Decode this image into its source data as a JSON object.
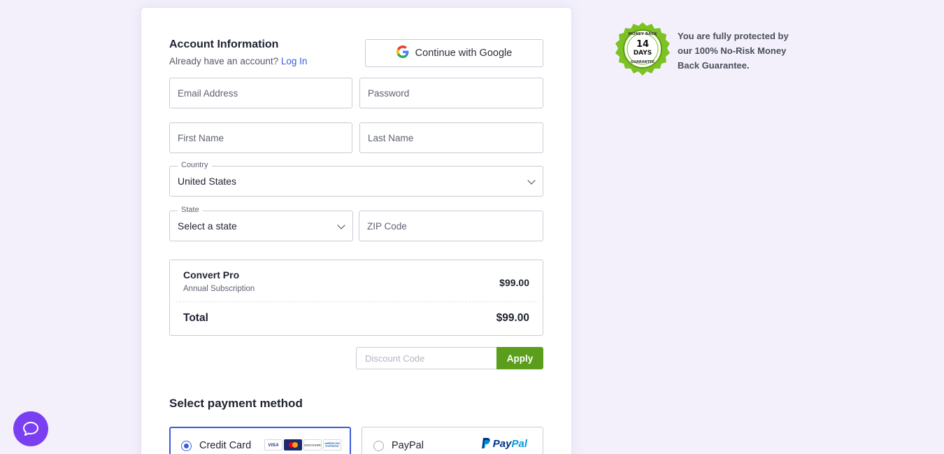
{
  "account": {
    "title": "Account Information",
    "subtitle_prefix": "Already have an account?",
    "login_link": "Log In",
    "google_button": "Continue with Google"
  },
  "form": {
    "email_placeholder": "Email Address",
    "password_placeholder": "Password",
    "first_name_placeholder": "First Name",
    "last_name_placeholder": "Last Name",
    "country_label": "Country",
    "country_value": "United States",
    "state_label": "State",
    "state_value": "Select a state",
    "zip_placeholder": "ZIP Code"
  },
  "summary": {
    "product_name": "Convert Pro",
    "product_plan": "Annual Subscription",
    "product_price": "$99.00",
    "total_label": "Total",
    "total_price": "$99.00"
  },
  "discount": {
    "placeholder": "Discount Code",
    "apply_label": "Apply"
  },
  "payment": {
    "title": "Select payment method",
    "options": [
      {
        "label": "Credit Card",
        "selected": true
      },
      {
        "label": "PayPal",
        "selected": false
      }
    ],
    "card_brands": [
      "VISA",
      "DISCOVER",
      "AMERICAN EXPRESS"
    ],
    "paypal_logo_text": "PayPal"
  },
  "guarantee": {
    "badge_top": "MONEY BACK",
    "badge_number": "14",
    "badge_unit": "DAYS",
    "badge_bottom": "GUARANTEE",
    "text": "You are fully protected by our 100% No-Risk Money Back Guarantee."
  },
  "colors": {
    "accent": "#3b5bdb",
    "apply_green": "#5a9e1b",
    "badge_green": "#7cc223",
    "chat_purple": "#7b3ff2",
    "background": "#f3f0fb"
  },
  "icons": {
    "google": "google-g-icon",
    "chevron": "chevron-down-icon",
    "chat": "chat-bubble-icon",
    "badge": "money-back-badge-icon"
  }
}
